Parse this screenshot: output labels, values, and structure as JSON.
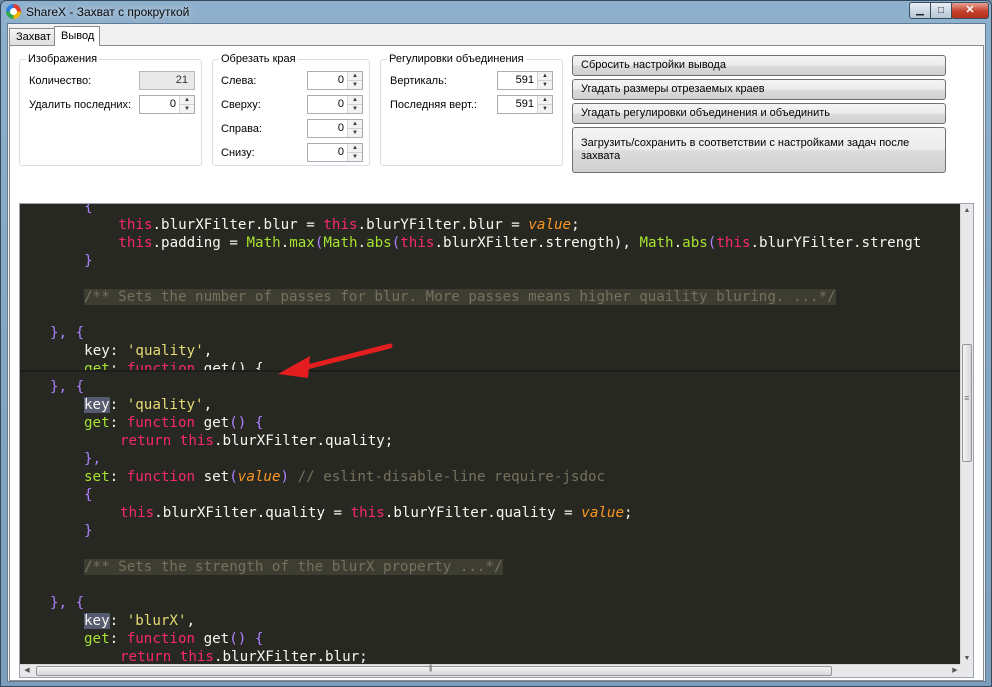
{
  "window": {
    "title": "ShareX - Захват с прокруткой",
    "buttons": {
      "minimize": "▁",
      "maximize": "□",
      "close": "✕"
    }
  },
  "tabs": [
    {
      "label": "Захват"
    },
    {
      "label": "Вывод"
    }
  ],
  "images_group": {
    "title": "Изображения",
    "count_label": "Количество:",
    "count_value": "21",
    "remove_last_label": "Удалить последних:",
    "remove_last_value": "0"
  },
  "trim_group": {
    "title": "Обрезать края",
    "left_label": "Слева:",
    "left_value": "0",
    "top_label": "Сверху:",
    "top_value": "0",
    "right_label": "Справа:",
    "right_value": "0",
    "bottom_label": "Снизу:",
    "bottom_value": "0"
  },
  "combine_group": {
    "title": "Регулировки объединения",
    "vertical_label": "Вертикаль:",
    "vertical_value": "591",
    "last_vertical_label": "Последняя верт.:",
    "last_vertical_value": "591"
  },
  "actions": {
    "reset_output": "Сбросить настройки вывода",
    "guess_edges": "Угадать размеры отрезаемых краев",
    "guess_combine": "Угадать регулировки объединения и объединить",
    "upload_save": "Загрузить/сохранить в соответствии с настройками задач после захвата"
  },
  "code": {
    "l1": "    {",
    "l2a": "        ",
    "l2b": "this",
    "l2c": ".blurXFilter.blur = ",
    "l2d": "this",
    "l2e": ".blurYFilter.blur = ",
    "l2f": "value",
    "l2g": ";",
    "l3a": "        ",
    "l3b": "this",
    "l3c": ".padding = ",
    "l3d": "Math",
    "l3e": ".",
    "l3f": "max",
    "l3g": "(",
    "l3h": "Math",
    "l3i": ".",
    "l3j": "abs",
    "l3k": "(",
    "l3l": "this",
    "l3m": ".blurXFilter.strength), ",
    "l3n": "Math",
    "l3o": ".",
    "l3p": "abs",
    "l3q": "(",
    "l3r": "this",
    "l3s": ".blurYFilter.strengt",
    "l4": "    }",
    "l5": "/** Sets the number of passes for blur. More passes means higher quaility bluring. ...*/",
    "l6a": "}",
    "l6b": ", {",
    "l7a": "    key",
    "l7b": ": ",
    "l7c": "'quality'",
    "l7d": ",",
    "l8a": "    get",
    "l8b": ": ",
    "l8c": "function",
    "l8d": " get() {",
    "m1a": "}",
    "m1b": ", {",
    "m2a": "key",
    "m2b": ": ",
    "m2c": "'quality'",
    "m2d": ",",
    "m3a": "get",
    "m3b": ": ",
    "m3c": "function",
    "m3d": " get",
    "m3e": "() {",
    "m4a": "return",
    "m4b": " this",
    "m4c": ".blurXFilter.quality;",
    "m5": "},",
    "m6a": "set",
    "m6b": ": ",
    "m6c": "function",
    "m6d": " set",
    "m6e": "(",
    "m6f": "value",
    "m6g": ") ",
    "m6h": "// eslint-disable-line require-jsdoc",
    "m7": "{",
    "m8a": "this",
    "m8b": ".blurXFilter.quality = ",
    "m8c": "this",
    "m8d": ".blurYFilter.quality = ",
    "m8e": "value",
    "m8f": ";",
    "m9": "}",
    "m10": "/** Sets the strength of the blurX property ...*/",
    "m11a": "}",
    "m11b": ", {",
    "m12a": "key",
    "m12b": ": ",
    "m12c": "'blurX'",
    "m12d": ",",
    "m13a": "get",
    "m13b": ": ",
    "m13c": "function",
    "m13d": " get",
    "m13e": "() {",
    "m14a": "return",
    "m14b": " this",
    "m14c": ".blurXFilter.blur;",
    "m15": "}"
  },
  "annotation_color": "#e41e1e"
}
